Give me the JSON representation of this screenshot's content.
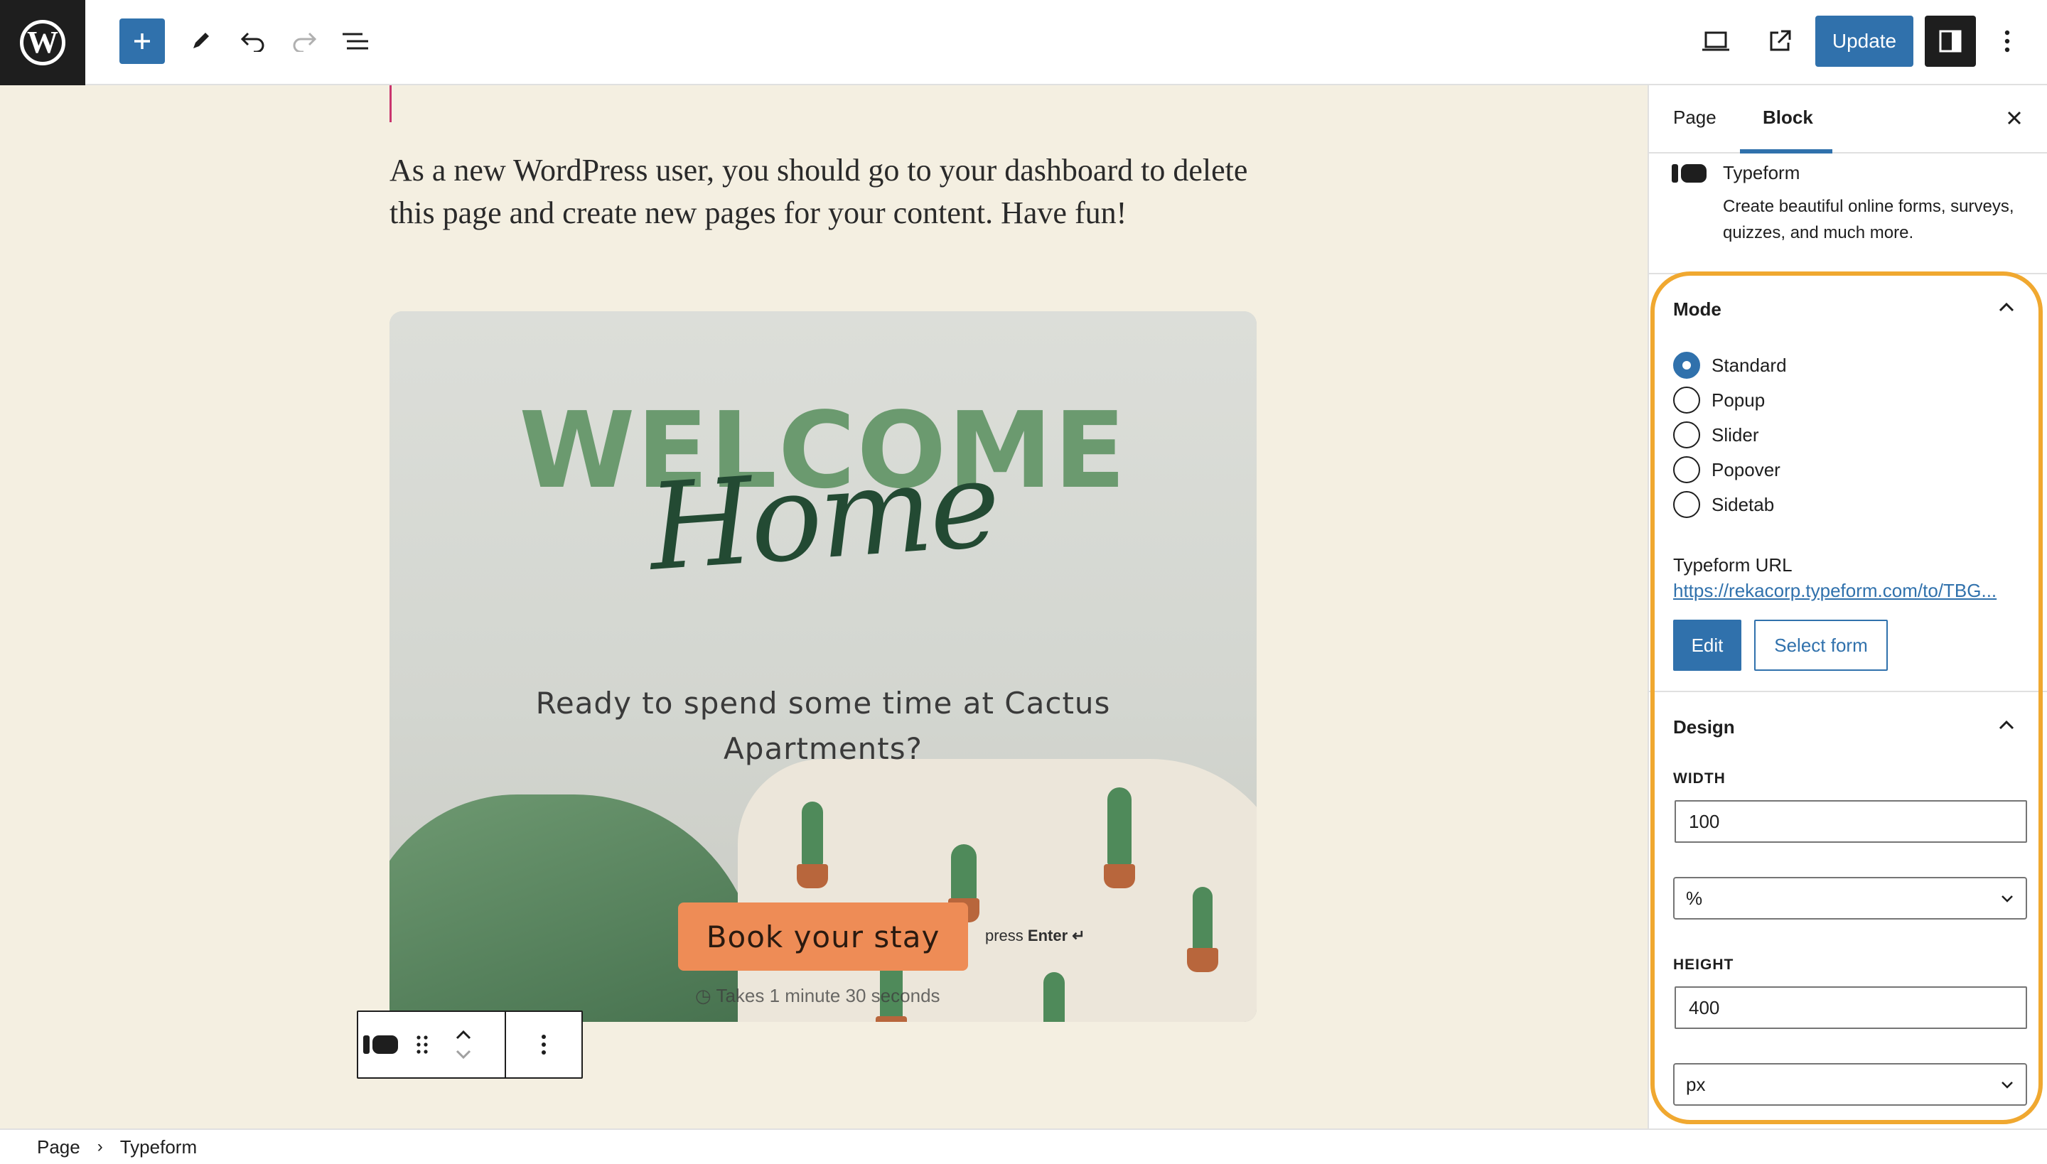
{
  "topbar": {
    "logo": "W",
    "update_label": "Update",
    "icons": {
      "add": "plus-icon",
      "tools": "pencil-icon",
      "undo": "undo-icon",
      "redo": "redo-icon",
      "outline": "list-view-icon",
      "preview": "laptop-preview-icon",
      "view_page": "external-link-icon",
      "settings": "sidebar-toggle-icon",
      "options": "vertical-ellipsis-icon"
    }
  },
  "canvas": {
    "paragraph": "As a new WordPress user, you should go to your dashboard to delete this page and create new pages for your content. Have fun!",
    "embed": {
      "headline": "WELCOME",
      "script": "Home",
      "question": "Ready to spend some time at Cactus Apartments?",
      "cta_label": "Book your stay",
      "press_text": "press",
      "press_key": "Enter ↵",
      "time_hint": "Takes 1 minute 30 seconds"
    }
  },
  "sidebar": {
    "tabs": [
      {
        "label": "Page",
        "active": false
      },
      {
        "label": "Block",
        "active": true
      }
    ],
    "block": {
      "title": "Typeform",
      "description": "Create beautiful online forms, surveys, quizzes, and much more."
    },
    "mode": {
      "title": "Mode",
      "options": [
        "Standard",
        "Popup",
        "Slider",
        "Popover",
        "Sidetab"
      ],
      "selected": "Standard"
    },
    "url": {
      "label": "Typeform URL",
      "value": "https://rekacorp.typeform.com/to/TBG..."
    },
    "buttons": {
      "edit": "Edit",
      "select_form": "Select form"
    },
    "design": {
      "title": "Design",
      "width_label": "WIDTH",
      "width_value": "100",
      "width_unit": "%",
      "height_label": "HEIGHT",
      "height_value": "400",
      "height_unit": "px"
    }
  },
  "breadcrumb": [
    "Page",
    "Typeform"
  ],
  "colors": {
    "accent": "#3071ac",
    "canvas_bg": "#f4efe1",
    "highlight": "#f0a830",
    "cta": "#ee8c56"
  }
}
